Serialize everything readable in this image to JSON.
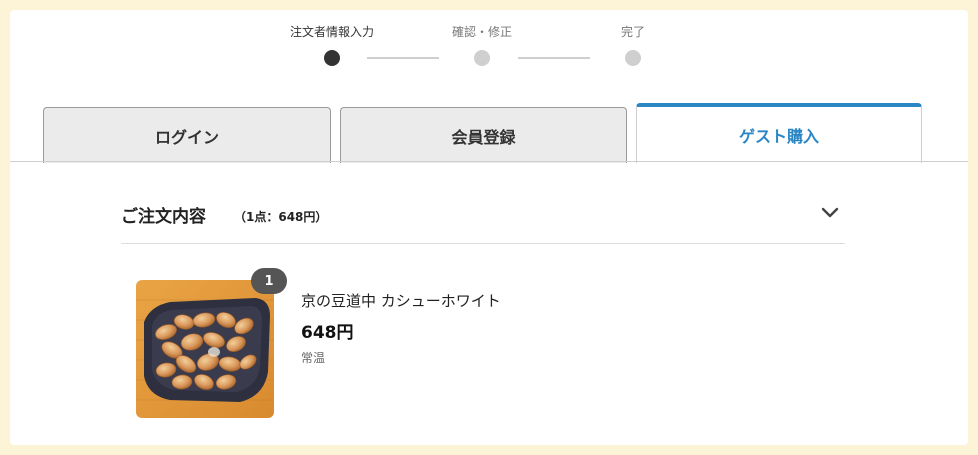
{
  "stepper": {
    "steps": [
      {
        "label": "注文者情報入力",
        "active": true
      },
      {
        "label": "確認・修正",
        "active": false
      },
      {
        "label": "完了",
        "active": false
      }
    ]
  },
  "tabs": [
    {
      "label": "ログイン",
      "active": false
    },
    {
      "label": "会員登録",
      "active": false
    },
    {
      "label": "ゲスト購入",
      "active": true
    }
  ],
  "colors": {
    "accent": "#2a86c5",
    "active_step": "#333333",
    "inactive_step": "#cfcfcf"
  },
  "order_summary": {
    "title": "ご注文内容",
    "count": "（1点：648円）",
    "toggle_icon": "chevron-down-icon"
  },
  "items": [
    {
      "quantity": "1",
      "name": "京の豆道中 カシューホワイト",
      "price": "648円",
      "temperature": "常温"
    }
  ]
}
